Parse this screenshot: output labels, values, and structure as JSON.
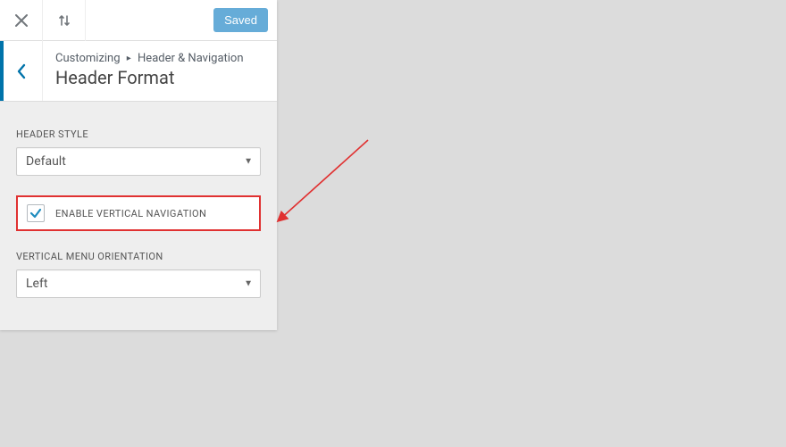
{
  "actions": {
    "saved_label": "Saved"
  },
  "breadcrumb": {
    "root": "Customizing",
    "section": "Header & Navigation",
    "title": "Header Format"
  },
  "headerStyle": {
    "label": "HEADER STYLE",
    "value": "Default"
  },
  "enableVertical": {
    "label": "ENABLE VERTICAL NAVIGATION",
    "checked": true
  },
  "orientation": {
    "label": "VERTICAL MENU ORIENTATION",
    "value": "Left"
  }
}
